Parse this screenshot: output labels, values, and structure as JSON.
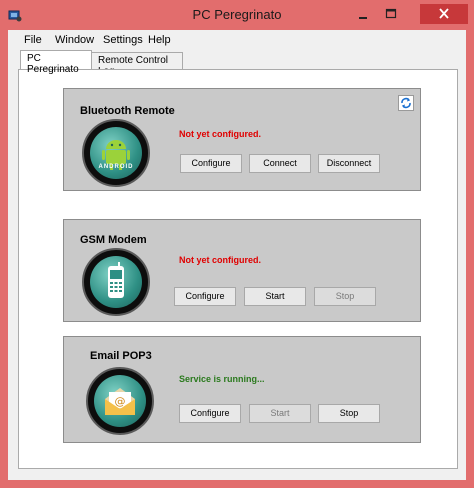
{
  "window": {
    "title": "PC Peregrinato"
  },
  "menu": [
    "File",
    "Window",
    "Settings",
    "Help"
  ],
  "tabs": [
    {
      "label": "PC Peregrinato",
      "active": true
    },
    {
      "label": "Remote Control Log",
      "active": false
    }
  ],
  "panels": {
    "bluetooth": {
      "title": "Bluetooth Remote",
      "status": "Not yet configured.",
      "icon_text": "ANDROID",
      "buttons": {
        "configure": "Configure",
        "connect": "Connect",
        "disconnect": "Disconnect"
      }
    },
    "gsm": {
      "title": "GSM Modem",
      "status": "Not yet configured.",
      "buttons": {
        "configure": "Configure",
        "start": "Start",
        "stop": "Stop"
      }
    },
    "email": {
      "title": "Email POP3",
      "status": "Service is running...",
      "buttons": {
        "configure": "Configure",
        "start": "Start",
        "stop": "Stop"
      }
    }
  },
  "colors": {
    "titlebar": "#e26d6d",
    "close": "#c7383a",
    "status_error": "#e00000",
    "status_ok": "#2b7a1e"
  }
}
